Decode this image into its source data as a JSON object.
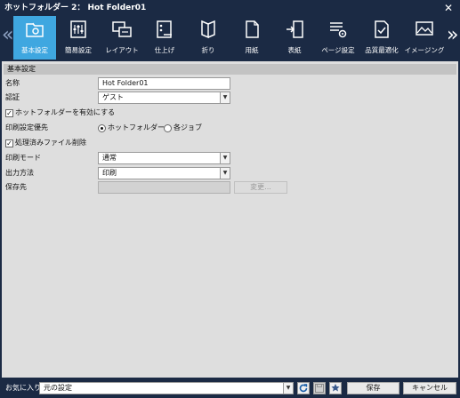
{
  "window": {
    "title": "ホットフォルダー 2： Hot Folder01",
    "close_glyph": "✕"
  },
  "toolbar": {
    "left_arrow": "«",
    "right_arrow": "»",
    "tabs": [
      {
        "label": "基本設定",
        "icon": "folder-gear-icon",
        "active": true
      },
      {
        "label": "簡易設定",
        "icon": "sliders-icon",
        "active": false
      },
      {
        "label": "レイアウト",
        "icon": "layout-icon",
        "active": false
      },
      {
        "label": "仕上げ",
        "icon": "finishing-icon",
        "active": false
      },
      {
        "label": "折り",
        "icon": "fold-icon",
        "active": false
      },
      {
        "label": "用紙",
        "icon": "paper-icon",
        "active": false
      },
      {
        "label": "表紙",
        "icon": "cover-icon",
        "active": false
      },
      {
        "label": "ページ設定",
        "icon": "page-settings-icon",
        "active": false
      },
      {
        "label": "品質最適化",
        "icon": "quality-icon",
        "active": false
      },
      {
        "label": "イメージング",
        "icon": "imaging-icon",
        "active": false
      }
    ]
  },
  "basic": {
    "section_title": "基本設定",
    "name_label": "名称",
    "name_value": "Hot Folder01",
    "auth_label": "認証",
    "auth_value": "ゲスト",
    "enable_label": "ホットフォルダーを有効にする",
    "enable_checked": true,
    "priority_label": "印刷設定優先",
    "priority_option_hotfolder": "ホットフォルダー",
    "priority_option_job": "各ジョブ",
    "delete_label": "処理済みファイル削除",
    "delete_checked": true,
    "mode_label": "印刷モード",
    "mode_value": "通常",
    "output_label": "出力方法",
    "output_value": "印刷",
    "dest_label": "保存先",
    "dest_value": "",
    "change_button": "変更..."
  },
  "footer": {
    "favorites_label": "お気に入り",
    "favorites_value": "元の設定",
    "save_button": "保存",
    "cancel_button": "キャンセル"
  },
  "colors": {
    "chrome": "#1b2a44",
    "active_tab": "#3fa7e0",
    "panel": "#dedede",
    "section_header": "#c3c3c3"
  }
}
